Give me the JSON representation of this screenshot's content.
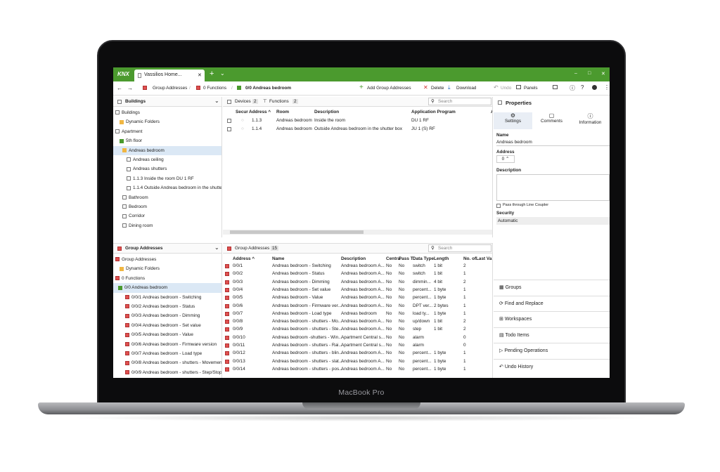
{
  "device": {
    "label": "MacBook Pro"
  },
  "app": {
    "logo": "KNX",
    "tab_title": "Vassilios Home...",
    "window_min": "–",
    "window_max": "□",
    "window_close": "✕"
  },
  "toolbar": {
    "crumb1": "Group Addresses",
    "crumb2": "0 Functions",
    "crumb3": "0/0 Andreas bedroom",
    "add": "Add Group Addresses",
    "delete": "Delete",
    "download": "Download",
    "undo": "Undo",
    "panels": "Panels"
  },
  "buildings": {
    "title": "Buildings",
    "items": [
      "Buildings",
      "Dynamic Folders",
      "Apartment",
      "5th floor",
      "Andreas bedroom",
      "Andreas ceiling",
      "Andreas shutters",
      "1.1.3 Inside the room DU 1 RF",
      "1.1.4 Outside Andreas bedroom in the shutte",
      "Bathroom",
      "Bedroom",
      "Corridor",
      "Dining room"
    ]
  },
  "devices": {
    "tab1": "Devices",
    "tab1_count": "2",
    "tab2": "Functions",
    "tab2_count": "2",
    "search": "Search",
    "headers": [
      "Secur",
      "Address ^",
      "Room",
      "Description",
      "Application Program",
      "A"
    ],
    "rows": [
      [
        "1.1.3",
        "Andreas bedroom",
        "Inside the room",
        "DU 1 RF"
      ],
      [
        "1.1.4",
        "Andreas bedroom",
        "Outside Andreas bedroom in the shutter box",
        "JU 1 (S) RF"
      ]
    ]
  },
  "properties": {
    "title": "Properties",
    "tab_settings": "Settings",
    "tab_comments": "Comments",
    "tab_info": "Information",
    "name_label": "Name",
    "name_value": "Andreas bedroom",
    "address_label": "Address",
    "address_value": "0",
    "desc_label": "Description",
    "pass_label": "Pass through Line Coupler",
    "security_label": "Security",
    "security_value": "Automatic"
  },
  "sidebar": [
    "Groups",
    "Find and Replace",
    "Workspaces",
    "Todo Items",
    "Pending Operations",
    "Undo History"
  ],
  "ga_tree": {
    "title": "Group Addresses",
    "items": [
      "Group Addresses",
      "Dynamic Folders",
      "0 Functions",
      "0/0 Andreas bedroom",
      "0/0/1 Andreas bedroom - Switching",
      "0/0/2 Andreas bedroom - Status",
      "0/0/3 Andreas bedroom - Dimming",
      "0/0/4 Andreas bedroom - Set value",
      "0/0/5 Andreas bedroom - Value",
      "0/0/6 Andreas bedroom -  Firmware version",
      "0/0/7 Andreas bedroom - Load type",
      "0/0/8 Andreas bedroom - shutters - Movement",
      "0/0/9 Andreas bedroom - shutters - Step/Stop"
    ]
  },
  "ga_table": {
    "tab": "Group Addresses",
    "count": "15",
    "search": "Search",
    "headers": [
      "Address ^",
      "Name",
      "Description",
      "Centra",
      "Pass T",
      "Data Type",
      "Length",
      "No. of",
      "Last Va"
    ],
    "rows": [
      [
        "0/0/1",
        "Andreas bedroom - Switching",
        "Andreas bedroom A...",
        "No",
        "No",
        "switch",
        "1 bit",
        "2"
      ],
      [
        "0/0/2",
        "Andreas bedroom - Status",
        "Andreas bedroom A...",
        "No",
        "No",
        "switch",
        "1 bit",
        "1"
      ],
      [
        "0/0/3",
        "Andreas bedroom - Dimming",
        "Andreas bedroom A...",
        "No",
        "No",
        "dimmin...",
        "4 bit",
        "2"
      ],
      [
        "0/0/4",
        "Andreas bedroom - Set value",
        "Andreas bedroom A...",
        "No",
        "No",
        "percent...",
        "1 byte",
        "1"
      ],
      [
        "0/0/5",
        "Andreas bedroom - Value",
        "Andreas bedroom A...",
        "No",
        "No",
        "percent...",
        "1 byte",
        "1"
      ],
      [
        "0/0/6",
        "Andreas bedroom -  Firmware ver...",
        "Andreas bedroom A...",
        "No",
        "No",
        "DPT ver...",
        "2 bytes",
        "1"
      ],
      [
        "0/0/7",
        "Andreas bedroom - Load type",
        "Andreas bedroom",
        "No",
        "No",
        "load ty...",
        "1 byte",
        "1"
      ],
      [
        "0/0/8",
        "Andreas bedroom - shutters - Mo...",
        "Andreas bedroom A...",
        "No",
        "No",
        "up/down",
        "1 bit",
        "2"
      ],
      [
        "0/0/9",
        "Andreas bedroom - shutters - Ste...",
        "Andreas bedroom A...",
        "No",
        "No",
        "step",
        "1 bit",
        "2"
      ],
      [
        "0/0/10",
        "Andreas bedroom -shutters - Win...",
        "Apartment Central s...",
        "No",
        "No",
        "alarm",
        "",
        "0"
      ],
      [
        "0/0/11",
        "Andreas bedroom - shutters - Rai...",
        "Apartment Central s...",
        "No",
        "No",
        "alarm",
        "",
        "0"
      ],
      [
        "0/0/12",
        "Andreas bedroom - shutters - blin...",
        "Andreas bedroom A...",
        "No",
        "No",
        "percent...",
        "1 byte",
        "1"
      ],
      [
        "0/0/13",
        "Andreas bedroom - shutters - slat...",
        "Andreas bedroom A...",
        "No",
        "No",
        "percent...",
        "1 byte",
        "1"
      ],
      [
        "0/0/14",
        "Andreas bedroom - shutters - pos...",
        "Andreas bedroom A...",
        "No",
        "No",
        "percent...",
        "1 byte",
        "1"
      ]
    ]
  }
}
